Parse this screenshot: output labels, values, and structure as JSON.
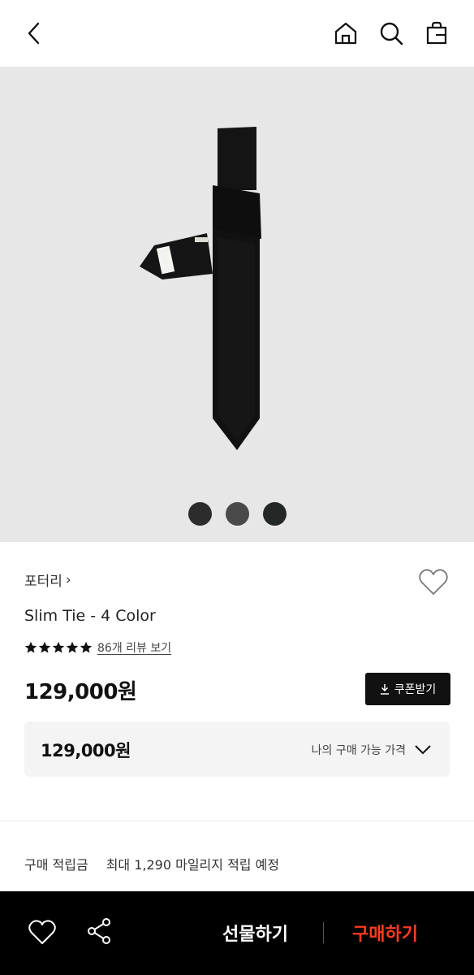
{
  "header": {
    "icons": [
      "back-icon",
      "home-icon",
      "search-icon",
      "shopping-bag-icon"
    ]
  },
  "gallery": {
    "color_swatches": [
      "#2c2c2c",
      "#4a4a4a",
      "#232826"
    ]
  },
  "product": {
    "brand": "포터리",
    "brand_chevron": "›",
    "name": "Slim Tie - 4 Color",
    "rating_stars": 5,
    "reviews_link": "86개 리뷰 보기",
    "price": "129,000원",
    "coupon_button": "쿠폰받기"
  },
  "my_price": {
    "price": "129,000원",
    "label": "나의 구매 가능 가격"
  },
  "reward": {
    "label": "구매 적립금",
    "value": "최대 1,290 마일리지 적립 예정"
  },
  "bottom_bar": {
    "gift_label": "선물하기",
    "buy_label": "구매하기",
    "buy_color": "#ff3b1f"
  }
}
